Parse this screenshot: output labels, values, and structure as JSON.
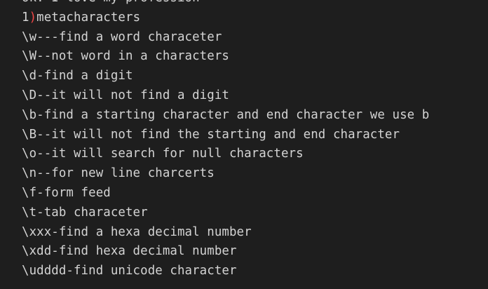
{
  "editor": {
    "top_partial_line": "ok. I love my profession",
    "heading": {
      "number": "1",
      "paren": ")",
      "text": "metacharacters"
    },
    "lines": [
      "\\w---find a word characeter",
      "\\W--not word in a characters",
      "\\d-find a digit",
      "\\D--it will not find a digit",
      "\\b-find a starting character and end character we use b",
      "\\B--it will not find the starting and end character",
      "\\o--it will search for null characters",
      "\\n--for new line charcerts",
      "\\f-form feed",
      "\\t-tab characeter",
      "\\xxx-find a hexa decimal number",
      "\\xdd-find hexa decimal number",
      "\\udddd-find unicode character"
    ],
    "colors": {
      "background": "#1e1e1e",
      "text": "#d4d4d4",
      "paren": "#f44747"
    }
  }
}
